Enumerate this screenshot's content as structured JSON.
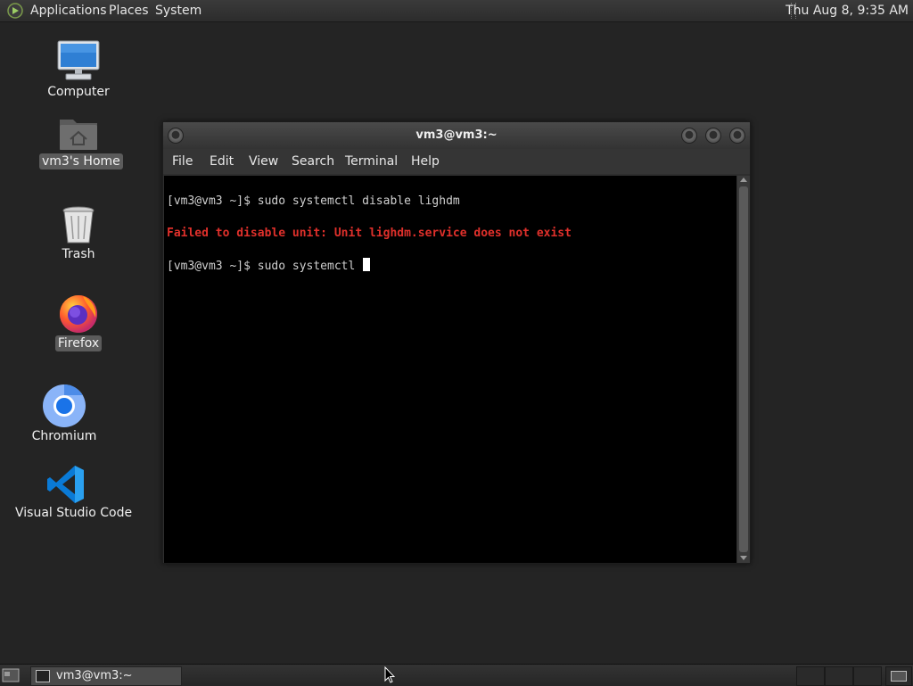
{
  "top_panel": {
    "menus": [
      "Applications",
      "Places",
      "System"
    ],
    "clock": "Thu Aug  8,  9:35 AM"
  },
  "desktop": {
    "icons": [
      {
        "label": "Computer",
        "icon": "computer-icon"
      },
      {
        "label": "vm3's Home",
        "icon": "home-folder-icon"
      },
      {
        "label": "Trash",
        "icon": "trash-icon"
      },
      {
        "label": "Firefox",
        "icon": "firefox-icon"
      },
      {
        "label": "Chromium",
        "icon": "chromium-icon"
      },
      {
        "label": "Visual Studio Code",
        "icon": "vscode-icon"
      }
    ]
  },
  "terminal": {
    "title": "vm3@vm3:~",
    "menu": [
      "File",
      "Edit",
      "View",
      "Search",
      "Terminal",
      "Help"
    ],
    "lines": [
      {
        "text": "[vm3@vm3 ~]$ sudo systemctl disable lighdm",
        "kind": "normal"
      },
      {
        "text": "Failed to disable unit: Unit lighdm.service does not exist",
        "kind": "error"
      },
      {
        "text": "[vm3@vm3 ~]$ sudo systemctl ",
        "kind": "prompt"
      }
    ]
  },
  "taskbar": {
    "task_label": "vm3@vm3:~"
  },
  "colors": {
    "error_text": "#e0302b",
    "terminal_bg": "#000000",
    "desktop_bg": "#242424"
  }
}
